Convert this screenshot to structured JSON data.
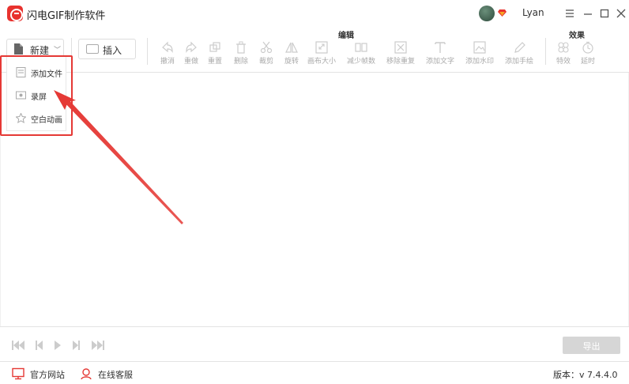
{
  "app": {
    "title": "闪电GIF制作软件",
    "username": "Lyan"
  },
  "toolbar": {
    "new_label": "新建",
    "insert_label": "插入",
    "group_edit": "编辑",
    "group_effects": "效果",
    "tools": [
      {
        "label": "撤消",
        "icon": "undo-icon"
      },
      {
        "label": "重做",
        "icon": "redo-icon"
      },
      {
        "label": "重置",
        "icon": "reset-icon"
      },
      {
        "label": "删除",
        "icon": "trash-icon"
      },
      {
        "label": "裁剪",
        "icon": "scissors-icon"
      },
      {
        "label": "旋转",
        "icon": "rotate-icon"
      },
      {
        "label": "画布大小",
        "icon": "canvas-size-icon"
      },
      {
        "label": "减少帧数",
        "icon": "reduce-frames-icon"
      },
      {
        "label": "移除重复",
        "icon": "remove-duplicates-icon"
      },
      {
        "label": "添加文字",
        "icon": "text-icon"
      },
      {
        "label": "添加水印",
        "icon": "watermark-icon"
      },
      {
        "label": "添加手绘",
        "icon": "pen-icon"
      },
      {
        "label": "特效",
        "icon": "effects-icon"
      },
      {
        "label": "延时",
        "icon": "clock-icon"
      }
    ]
  },
  "dropdown": {
    "items": [
      {
        "label": "添加文件",
        "icon": "add-file-icon"
      },
      {
        "label": "录屏",
        "icon": "record-screen-icon"
      },
      {
        "label": "空白动画",
        "icon": "blank-animation-icon"
      }
    ]
  },
  "playbar": {
    "export_label": "导出"
  },
  "statusbar": {
    "website_label": "官方网站",
    "support_label": "在线客服",
    "version_text": "版本：v 7.4.4.0"
  },
  "colors": {
    "brand": "#e8322e",
    "highlight": "#e53935",
    "disabled": "#d6d6d6"
  }
}
